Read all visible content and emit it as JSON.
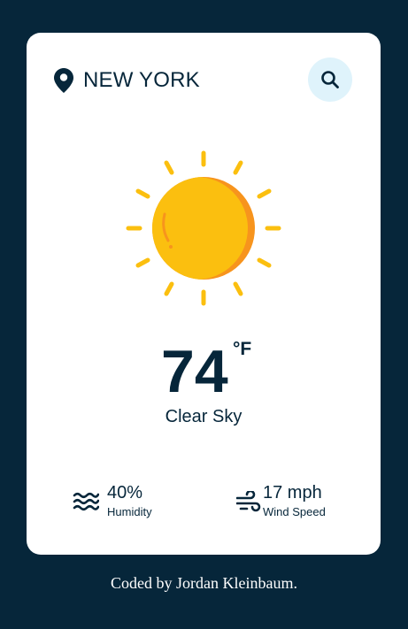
{
  "location": {
    "city": "NEW YORK",
    "icon": "map-pin-icon"
  },
  "search": {
    "icon": "search-icon"
  },
  "weather": {
    "icon": "sun-icon",
    "temperature": "74",
    "unit": "°F",
    "description": "Clear Sky"
  },
  "stats": {
    "humidity": {
      "value": "40%",
      "label": "Humidity",
      "icon": "humidity-waves-icon"
    },
    "wind": {
      "value": "17 mph",
      "label": "Wind Speed",
      "icon": "wind-icon"
    }
  },
  "footer": {
    "credit": "Coded by Jordan Kleinbaum."
  },
  "colors": {
    "background": "#06263a",
    "card": "#ffffff",
    "text": "#06263a",
    "search_button_bg": "#dff3fb",
    "sun": "#fbbf0f",
    "sun_shadow": "#f7941d",
    "sun_rays": "#fbbf0f"
  }
}
